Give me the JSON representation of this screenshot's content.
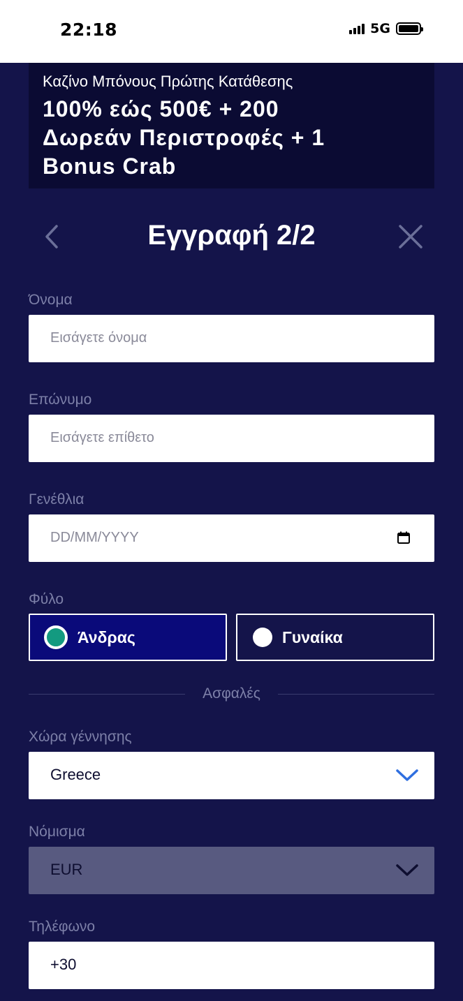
{
  "status_bar": {
    "time": "22:18",
    "network": "5G"
  },
  "promo": {
    "subtitle": "Καζίνο Μπόνους Πρώτης Κατάθεσης",
    "title_line1": "100% εώς 500€ + 200",
    "title_line2": "Δωρεάν Περιστροφές + 1",
    "title_line3": "Bonus Crab"
  },
  "header": {
    "title": "Εγγραφή 2/2"
  },
  "form": {
    "first_name": {
      "label": "Όνομα",
      "placeholder": "Εισάγετε όνομα"
    },
    "last_name": {
      "label": "Επώνυμο",
      "placeholder": "Εισάγετε επίθετο"
    },
    "birthday": {
      "label": "Γενέθλια",
      "placeholder": "DD/MM/YYYY"
    },
    "gender": {
      "label": "Φύλο",
      "male": "Άνδρας",
      "female": "Γυναίκα",
      "selected": "male"
    },
    "secure_divider": "Ασφαλές",
    "birth_country": {
      "label": "Χώρα γέννησης",
      "value": "Greece"
    },
    "currency": {
      "label": "Νόμισμα",
      "value": "EUR"
    },
    "phone": {
      "label": "Τηλέφωνο",
      "value": "+30"
    }
  },
  "colors": {
    "background": "#14144a",
    "accent_blue": "#2f6fe0",
    "radio_selected": "#139a80",
    "male_selected_bg": "#0a0a7a"
  }
}
